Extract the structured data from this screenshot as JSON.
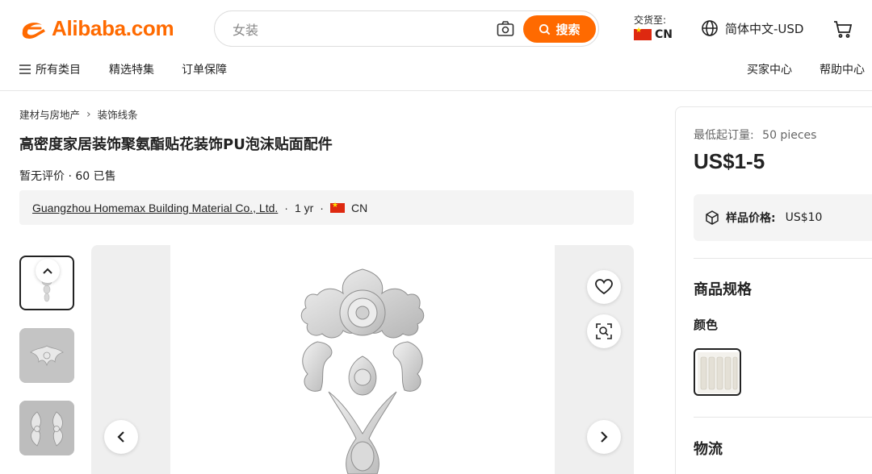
{
  "header": {
    "logo_text": "Alibaba.com",
    "search_placeholder": "女装",
    "search_button": "搜索",
    "ship_to_label": "交货至:",
    "ship_to_country": "CN",
    "language_currency": "简体中文-USD"
  },
  "nav": {
    "all_categories": "所有类目",
    "featured": "精选特集",
    "order_protection": "订单保障",
    "buyer_center": "买家中心",
    "help_center": "帮助中心"
  },
  "breadcrumb": [
    "建材与房地产",
    "装饰线条"
  ],
  "product": {
    "title": "高密度家居装饰聚氨酯贴花装饰PU泡沫贴面配件",
    "meta": "暂无评价 · 60 已售",
    "supplier_name": "Guangzhou Homemax Building Material Co., Ltd.",
    "supplier_years": "1 yr",
    "supplier_country": "CN"
  },
  "panel": {
    "moq_label": "最低起订量:",
    "moq_value": "50 pieces",
    "price": "US$1-5",
    "sample_label": "样品价格:",
    "sample_value": "US$10",
    "spec_title": "商品规格",
    "color_label": "颜色",
    "logistics_title": "物流"
  },
  "colors": {
    "brand": "#ff6a00",
    "text": "#222222",
    "muted": "#666666",
    "panel_bg": "#f4f4f4"
  }
}
